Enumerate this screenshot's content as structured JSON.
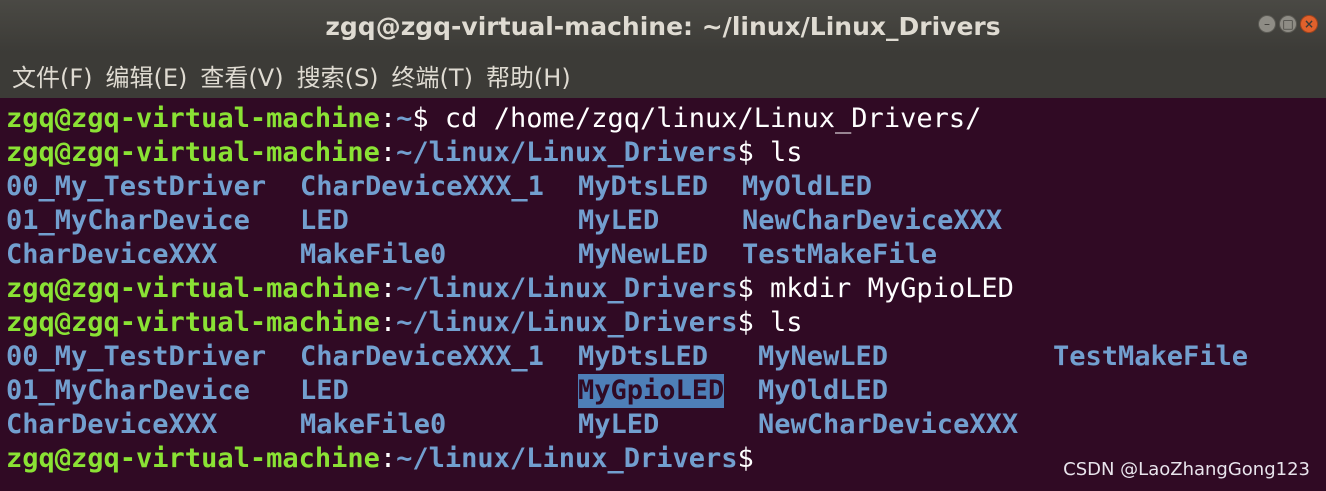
{
  "window": {
    "title": "zgq@zgq-virtual-machine: ~/linux/Linux_Drivers",
    "controls": [
      "minimize-icon",
      "maximize-icon",
      "close-icon"
    ],
    "controls_glyphs": {
      "minimize": "–",
      "maximize": "□",
      "close": "×"
    }
  },
  "menubar": {
    "items": [
      "文件(F)",
      "编辑(E)",
      "查看(V)",
      "搜索(S)",
      "终端(T)",
      "帮助(H)"
    ]
  },
  "terminal": {
    "colors": {
      "background": "#300a24",
      "user": "#8ae234",
      "path": "#729fcf",
      "directory": "#729fcf",
      "selection": "#4e7fb8"
    },
    "prompts": [
      {
        "user": "zgq@zgq-virtual-machine",
        "colon": ":",
        "path": "~",
        "dollar": "$ ",
        "command": "cd /home/zgq/linux/Linux_Drivers/"
      },
      {
        "user": "zgq@zgq-virtual-machine",
        "colon": ":",
        "path": "~/linux/Linux_Drivers",
        "dollar": "$ ",
        "command": "ls"
      },
      {
        "user": "zgq@zgq-virtual-machine",
        "colon": ":",
        "path": "~/linux/Linux_Drivers",
        "dollar": "$ ",
        "command": "mkdir MyGpioLED"
      },
      {
        "user": "zgq@zgq-virtual-machine",
        "colon": ":",
        "path": "~/linux/Linux_Drivers",
        "dollar": "$ ",
        "command": "ls"
      },
      {
        "user": "zgq@zgq-virtual-machine",
        "colon": ":",
        "path": "~/linux/Linux_Drivers",
        "dollar": "$",
        "command": ""
      }
    ],
    "ls_output_1": [
      [
        "00_My_TestDriver",
        "CharDeviceXXX_1",
        "MyDtsLED",
        "MyOldLED"
      ],
      [
        "01_MyCharDevice",
        "LED",
        "MyLED",
        "NewCharDeviceXXX"
      ],
      [
        "CharDeviceXXX",
        "MakeFile0",
        "MyNewLED",
        "TestMakeFile"
      ]
    ],
    "ls_output_2": [
      [
        "00_My_TestDriver",
        "CharDeviceXXX_1",
        "MyDtsLED",
        "MyNewLED",
        "TestMakeFile"
      ],
      [
        "01_MyCharDevice",
        "LED",
        "MyGpioLED",
        "MyOldLED",
        ""
      ],
      [
        "CharDeviceXXX",
        "MakeFile0",
        "MyLED",
        "NewCharDeviceXXX",
        ""
      ]
    ],
    "selected_entry": "MyGpioLED"
  },
  "watermark": "CSDN @LaoZhangGong123"
}
